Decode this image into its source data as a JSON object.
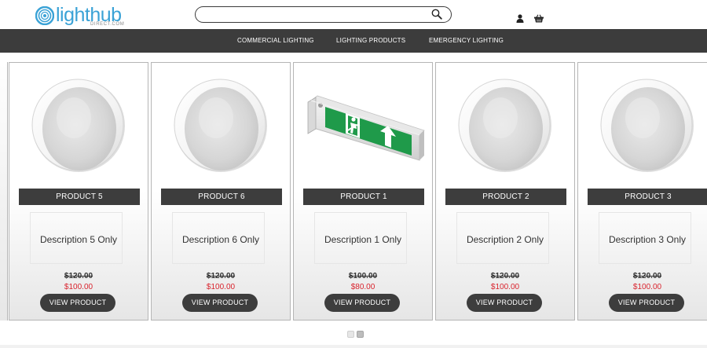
{
  "header": {
    "logo_text": "lighthub",
    "logo_subtext": "DIRECT.COM",
    "search": {
      "value": "",
      "placeholder": ""
    }
  },
  "nav": {
    "items": [
      {
        "label": "COMMERCIAL LIGHTING"
      },
      {
        "label": "LIGHTING PRODUCTS"
      },
      {
        "label": "EMERGENCY LIGHTING"
      }
    ]
  },
  "carousel": {
    "products": [
      {
        "title": "PRODUCT 5",
        "description": "Description 5 Only",
        "old_price": "$120.00",
        "price": "$100.00",
        "button": "VIEW PRODUCT",
        "image": "round-bulkhead-light"
      },
      {
        "title": "PRODUCT 6",
        "description": "Description 6 Only",
        "old_price": "$120.00",
        "price": "$100.00",
        "button": "VIEW PRODUCT",
        "image": "round-bulkhead-light"
      },
      {
        "title": "PRODUCT 1",
        "description": "Description 1 Only",
        "old_price": "$100.00",
        "price": "$80.00",
        "button": "VIEW PRODUCT",
        "image": "emergency-exit-sign"
      },
      {
        "title": "PRODUCT 2",
        "description": "Description 2 Only",
        "old_price": "$120.00",
        "price": "$100.00",
        "button": "VIEW PRODUCT",
        "image": "round-bulkhead-light"
      },
      {
        "title": "PRODUCT 3",
        "description": "Description 3 Only",
        "old_price": "$120.00",
        "price": "$100.00",
        "button": "VIEW PRODUCT",
        "image": "round-bulkhead-light"
      }
    ],
    "pagination": {
      "pages": 2,
      "active_page": 1
    }
  },
  "colors": {
    "brand_blue": "#3aa2d6",
    "nav_bg": "#3c3c3c",
    "sale_red": "#d9232d",
    "exit_sign_green": "#1f9a4a"
  }
}
